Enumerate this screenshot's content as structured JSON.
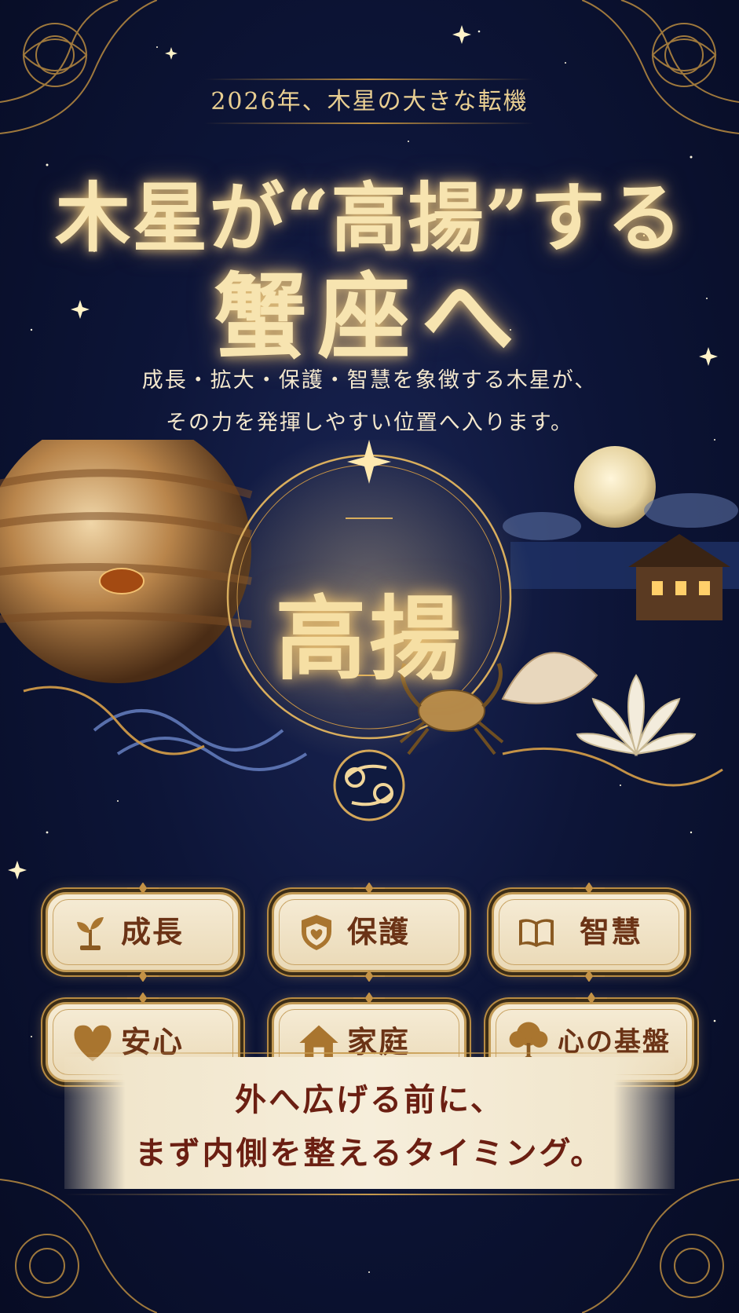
{
  "header": {
    "tagline": "2026年、木星の大きな転機",
    "title_line1": "木星が“高揚”する",
    "title_line2": "蟹座へ"
  },
  "subtitle": {
    "line1": "成長・拡大・保護・智慧を象徴する木星が、",
    "line2": "その力を発揮しやすい位置へ入ります。"
  },
  "center": {
    "word": "高揚"
  },
  "keywords": [
    {
      "label": "成長",
      "icon": "sprout-icon"
    },
    {
      "label": "保護",
      "icon": "shield-heart-icon"
    },
    {
      "label": "智慧",
      "icon": "open-book-icon"
    },
    {
      "label": "安心",
      "icon": "heart-icon"
    },
    {
      "label": "家庭",
      "icon": "house-icon"
    },
    {
      "label": "心の基盤",
      "icon": "tree-icon"
    }
  ],
  "banner": {
    "line1": "外へ広げる前に、",
    "line2": "まず内側を整えるタイミング。"
  },
  "colors": {
    "background": "#0d1538",
    "gold": "#e9cf92",
    "chip_text": "#6b3316",
    "banner_text": "#6b1f12"
  }
}
